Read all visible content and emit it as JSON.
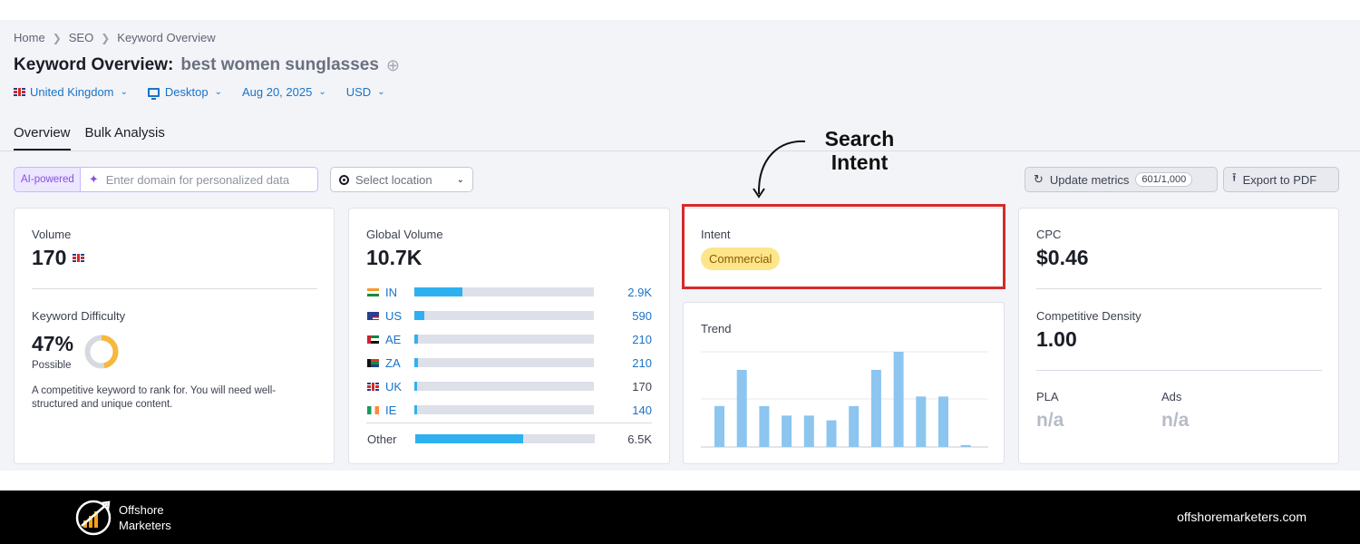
{
  "breadcrumb": [
    "Home",
    "SEO",
    "Keyword Overview"
  ],
  "title": {
    "prefix": "Keyword Overview:",
    "keyword": "best women sunglasses"
  },
  "filters": {
    "country": "United Kingdom",
    "device": "Desktop",
    "date": "Aug 20, 2025",
    "currency": "USD"
  },
  "tabs": [
    "Overview",
    "Bulk Analysis"
  ],
  "toolbar": {
    "ai_label": "AI-powered",
    "domain_placeholder": "Enter domain for personalized data",
    "location_placeholder": "Select location",
    "update_label": "Update metrics",
    "update_count": "601/1,000",
    "export_label": "Export to PDF"
  },
  "volume": {
    "label": "Volume",
    "value": "170"
  },
  "difficulty": {
    "label": "Keyword Difficulty",
    "value": "47%",
    "percent": 47,
    "level": "Possible",
    "description": "A competitive keyword to rank for. You will need well-structured and unique content.",
    "color": "#f6b93b"
  },
  "global_volume": {
    "label": "Global Volume",
    "value": "10.7K",
    "rows": [
      {
        "code": "IN",
        "value": "2.9K",
        "share": 0.27
      },
      {
        "code": "US",
        "value": "590",
        "share": 0.055
      },
      {
        "code": "AE",
        "value": "210",
        "share": 0.02
      },
      {
        "code": "ZA",
        "value": "210",
        "share": 0.02
      },
      {
        "code": "UK",
        "value": "170",
        "share": 0.016
      },
      {
        "code": "IE",
        "value": "140",
        "share": 0.013
      }
    ],
    "other": {
      "label": "Other",
      "value": "6.5K",
      "share": 0.6
    }
  },
  "intent": {
    "label": "Intent",
    "value": "Commercial"
  },
  "trend": {
    "label": "Trend",
    "values": [
      0.43,
      0.81,
      0.43,
      0.33,
      0.33,
      0.28,
      0.43,
      0.81,
      1.0,
      0.53,
      0.53,
      0.02
    ]
  },
  "cpc": {
    "label": "CPC",
    "value": "$0.46"
  },
  "competitive_density": {
    "label": "Competitive Density",
    "value": "1.00"
  },
  "pla": {
    "label": "PLA",
    "value": "n/a"
  },
  "ads": {
    "label": "Ads",
    "value": "n/a"
  },
  "annotation": {
    "line1": "Search",
    "line2": "Intent"
  },
  "footer": {
    "brand_line1": "Offshore",
    "brand_line2": "Marketers",
    "site": "offshoremarketers.com"
  },
  "colors": {
    "accent": "#1a73c8",
    "bar": "#2fb0f0",
    "trend_bar": "#8cc5ef",
    "annotation_box": "#d42a2a"
  }
}
